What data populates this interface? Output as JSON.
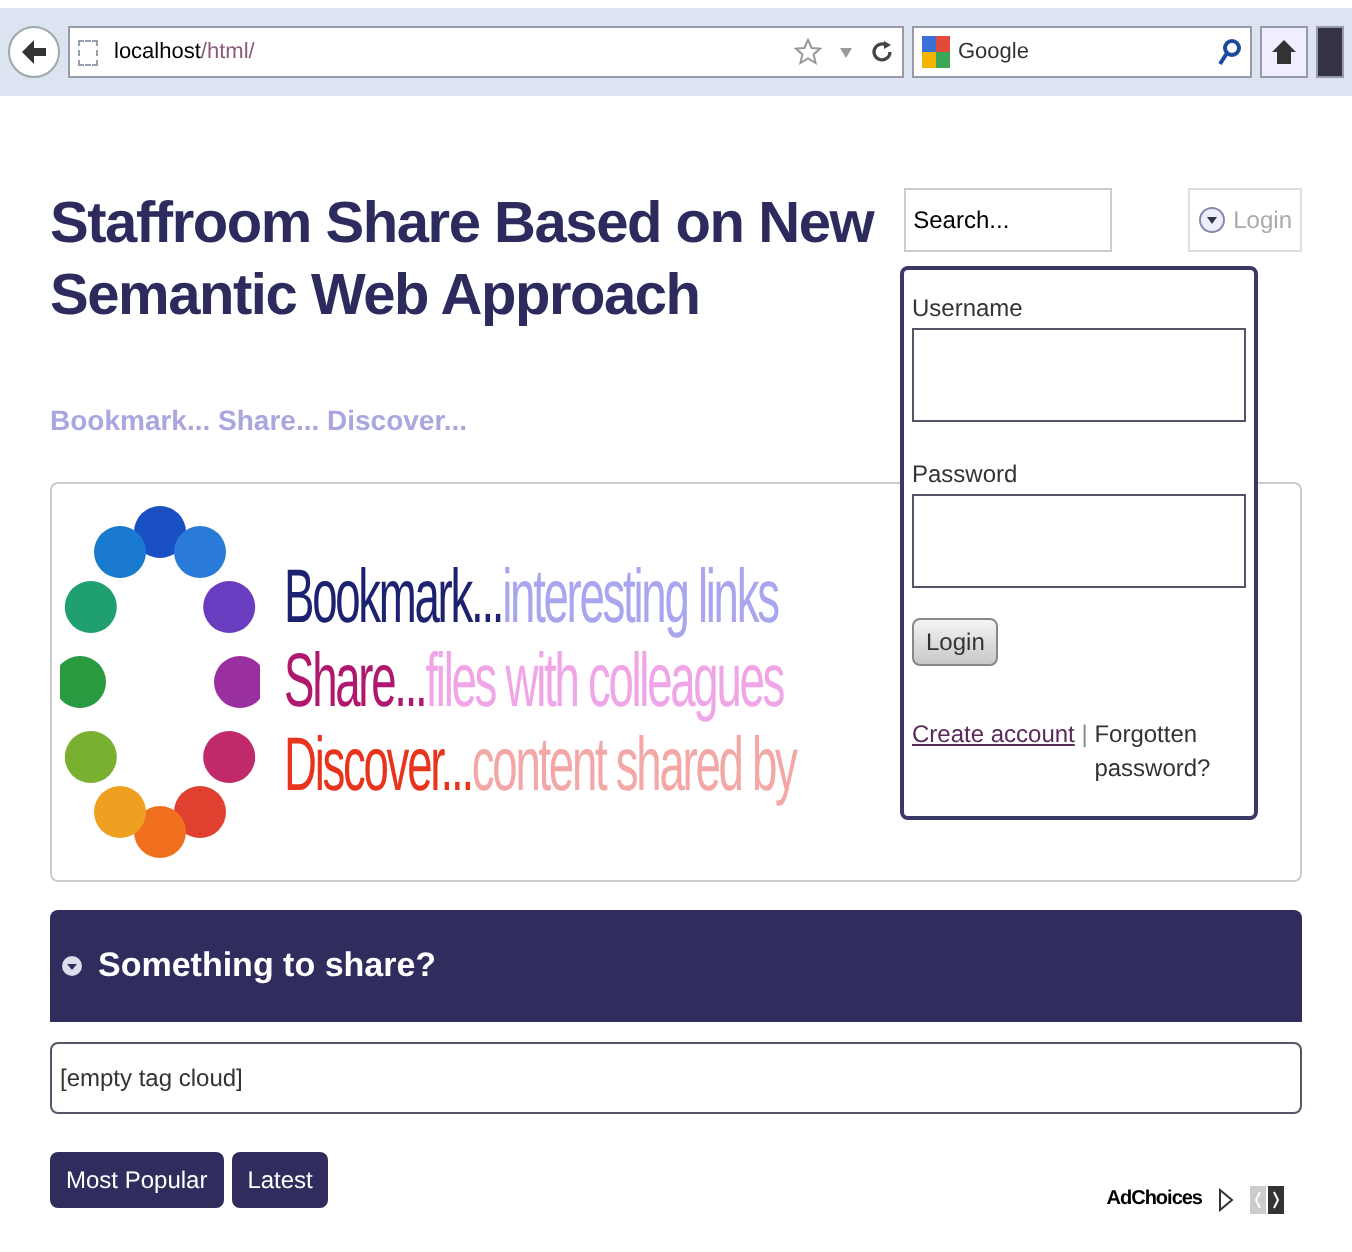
{
  "browser": {
    "url_host": "localhost",
    "url_path": "/html/",
    "search_engine": "Google"
  },
  "header": {
    "title": "Staffroom Share Based on New Semantic Web Approach",
    "tagline": "Bookmark... Share... Discover...",
    "search": {
      "placeholder": "Search..."
    },
    "login_toggle": "Login"
  },
  "login_panel": {
    "username_label": "Username",
    "password_label": "Password",
    "submit": "Login",
    "create_account": "Create account",
    "separator": "|",
    "forgotten": "Forgotten password?"
  },
  "banner": {
    "lines": [
      {
        "parts": [
          {
            "text": "Bookmark...",
            "color": "#1c2270"
          },
          {
            "text": "interesting links",
            "color": "#a9a6f0"
          }
        ]
      },
      {
        "parts": [
          {
            "text": "Share...",
            "color": "#b0186e"
          },
          {
            "text": "files with colleagues",
            "color": "#f0a6e6"
          }
        ]
      },
      {
        "parts": [
          {
            "text": "Discover...",
            "color": "#e8341c"
          },
          {
            "text": "content shared by",
            "color": "#f4a7a7"
          }
        ]
      }
    ]
  },
  "share_section": {
    "title": "Something to share?",
    "tag_cloud": "[empty tag cloud]"
  },
  "buttons": [
    "Most Popular",
    "Latest"
  ],
  "ad": {
    "label": "AdChoices"
  }
}
